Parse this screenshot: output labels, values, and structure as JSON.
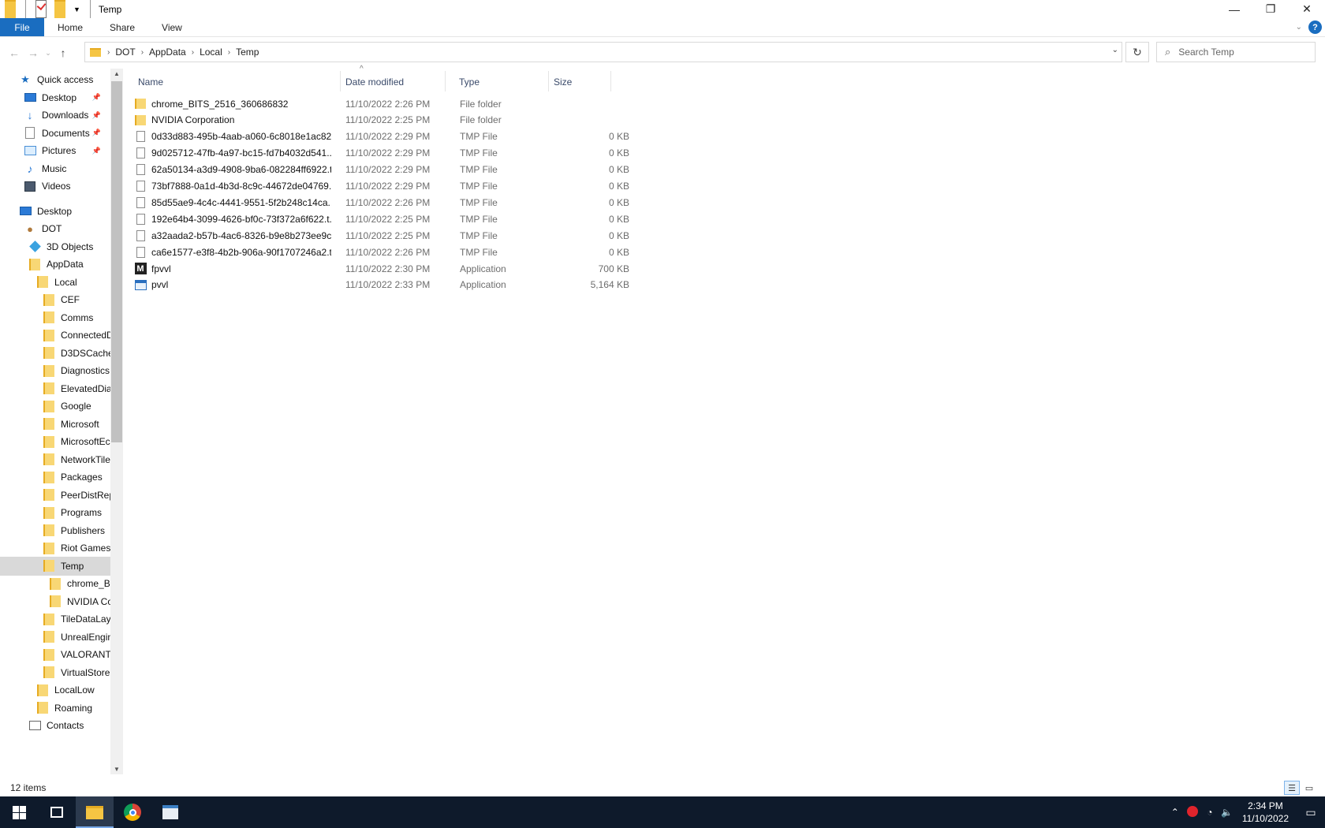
{
  "window": {
    "title": "Temp",
    "controls": {
      "minimize": "—",
      "restore": "❐",
      "close": "✕"
    }
  },
  "ribbon": {
    "tabs": [
      "File",
      "Home",
      "Share",
      "View"
    ],
    "help": "?"
  },
  "address": {
    "crumbs": [
      "DOT",
      "AppData",
      "Local",
      "Temp"
    ]
  },
  "search": {
    "placeholder": "Search Temp"
  },
  "sidebar": {
    "items": [
      {
        "label": "Quick access",
        "icon": "star-icon",
        "indent": 0
      },
      {
        "label": "Desktop",
        "icon": "desktop-icon",
        "indent": 1,
        "pinned": true
      },
      {
        "label": "Downloads",
        "icon": "download-icon",
        "indent": 1,
        "pinned": true
      },
      {
        "label": "Documents",
        "icon": "document-icon",
        "indent": 1,
        "pinned": true
      },
      {
        "label": "Pictures",
        "icon": "picture-icon",
        "indent": 1,
        "pinned": true
      },
      {
        "label": "Music",
        "icon": "music-icon",
        "indent": 1
      },
      {
        "label": "Videos",
        "icon": "video-icon",
        "indent": 1
      },
      {
        "label": "Desktop",
        "icon": "desktop-icon",
        "indent": 0
      },
      {
        "label": "DOT",
        "icon": "user-icon",
        "indent": 1
      },
      {
        "label": "3D Objects",
        "icon": "cube-icon",
        "indent": 2
      },
      {
        "label": "AppData",
        "icon": "folder-icon",
        "indent": 2
      },
      {
        "label": "Local",
        "icon": "folder-icon",
        "indent": 3
      },
      {
        "label": "CEF",
        "icon": "folder-icon",
        "indent": 4
      },
      {
        "label": "Comms",
        "icon": "folder-icon",
        "indent": 4
      },
      {
        "label": "ConnectedD",
        "icon": "folder-icon",
        "indent": 4
      },
      {
        "label": "D3DSCache",
        "icon": "folder-icon",
        "indent": 4
      },
      {
        "label": "Diagnostics",
        "icon": "folder-icon",
        "indent": 4
      },
      {
        "label": "ElevatedDia",
        "icon": "folder-icon",
        "indent": 4
      },
      {
        "label": "Google",
        "icon": "folder-icon",
        "indent": 4
      },
      {
        "label": "Microsoft",
        "icon": "folder-icon",
        "indent": 4
      },
      {
        "label": "MicrosoftEc",
        "icon": "folder-icon",
        "indent": 4
      },
      {
        "label": "NetworkTile",
        "icon": "folder-icon",
        "indent": 4
      },
      {
        "label": "Packages",
        "icon": "folder-icon",
        "indent": 4
      },
      {
        "label": "PeerDistRep",
        "icon": "folder-icon",
        "indent": 4
      },
      {
        "label": "Programs",
        "icon": "folder-icon",
        "indent": 4
      },
      {
        "label": "Publishers",
        "icon": "folder-icon",
        "indent": 4
      },
      {
        "label": "Riot Games",
        "icon": "folder-icon",
        "indent": 4
      },
      {
        "label": "Temp",
        "icon": "folder-icon",
        "indent": 4,
        "selected": true
      },
      {
        "label": "chrome_B",
        "icon": "folder-icon",
        "indent": 5
      },
      {
        "label": "NVIDIA Co",
        "icon": "folder-icon",
        "indent": 5
      },
      {
        "label": "TileDataLaye",
        "icon": "folder-icon",
        "indent": 4
      },
      {
        "label": "UnrealEngin",
        "icon": "folder-icon",
        "indent": 4
      },
      {
        "label": "VALORANT",
        "icon": "folder-icon",
        "indent": 4
      },
      {
        "label": "VirtualStore",
        "icon": "folder-icon",
        "indent": 4
      },
      {
        "label": "LocalLow",
        "icon": "folder-icon",
        "indent": 3
      },
      {
        "label": "Roaming",
        "icon": "folder-icon",
        "indent": 3
      },
      {
        "label": "Contacts",
        "icon": "contacts-icon",
        "indent": 2
      }
    ]
  },
  "columns": [
    "Name",
    "Date modified",
    "Type",
    "Size"
  ],
  "files": [
    {
      "name": "chrome_BITS_2516_360686832",
      "date": "11/10/2022 2:26 PM",
      "type": "File folder",
      "size": "",
      "icon": "folder-icon"
    },
    {
      "name": "NVIDIA Corporation",
      "date": "11/10/2022 2:25 PM",
      "type": "File folder",
      "size": "",
      "icon": "folder-icon"
    },
    {
      "name": "0d33d883-495b-4aab-a060-6c8018e1ac82...",
      "date": "11/10/2022 2:29 PM",
      "type": "TMP File",
      "size": "0 KB",
      "icon": "file-icon"
    },
    {
      "name": "9d025712-47fb-4a97-bc15-fd7b4032d541....",
      "date": "11/10/2022 2:29 PM",
      "type": "TMP File",
      "size": "0 KB",
      "icon": "file-icon"
    },
    {
      "name": "62a50134-a3d9-4908-9ba6-082284ff6922.t...",
      "date": "11/10/2022 2:29 PM",
      "type": "TMP File",
      "size": "0 KB",
      "icon": "file-icon"
    },
    {
      "name": "73bf7888-0a1d-4b3d-8c9c-44672de04769....",
      "date": "11/10/2022 2:29 PM",
      "type": "TMP File",
      "size": "0 KB",
      "icon": "file-icon"
    },
    {
      "name": "85d55ae9-4c4c-4441-9551-5f2b248c14ca....",
      "date": "11/10/2022 2:26 PM",
      "type": "TMP File",
      "size": "0 KB",
      "icon": "file-icon"
    },
    {
      "name": "192e64b4-3099-4626-bf0c-73f372a6f622.t...",
      "date": "11/10/2022 2:25 PM",
      "type": "TMP File",
      "size": "0 KB",
      "icon": "file-icon"
    },
    {
      "name": "a32aada2-b57b-4ac6-8326-b9e8b273ee9c....",
      "date": "11/10/2022 2:25 PM",
      "type": "TMP File",
      "size": "0 KB",
      "icon": "file-icon"
    },
    {
      "name": "ca6e1577-e3f8-4b2b-906a-90f1707246a2.t...",
      "date": "11/10/2022 2:26 PM",
      "type": "TMP File",
      "size": "0 KB",
      "icon": "file-icon"
    },
    {
      "name": "fpvvl",
      "date": "11/10/2022 2:30 PM",
      "type": "Application",
      "size": "700 KB",
      "icon": "m-app-icon"
    },
    {
      "name": "pvvl",
      "date": "11/10/2022 2:33 PM",
      "type": "Application",
      "size": "5,164 KB",
      "icon": "window-app-icon"
    }
  ],
  "status": {
    "count": "12 items"
  },
  "taskbar": {
    "time": "2:34 PM",
    "date": "11/10/2022"
  }
}
